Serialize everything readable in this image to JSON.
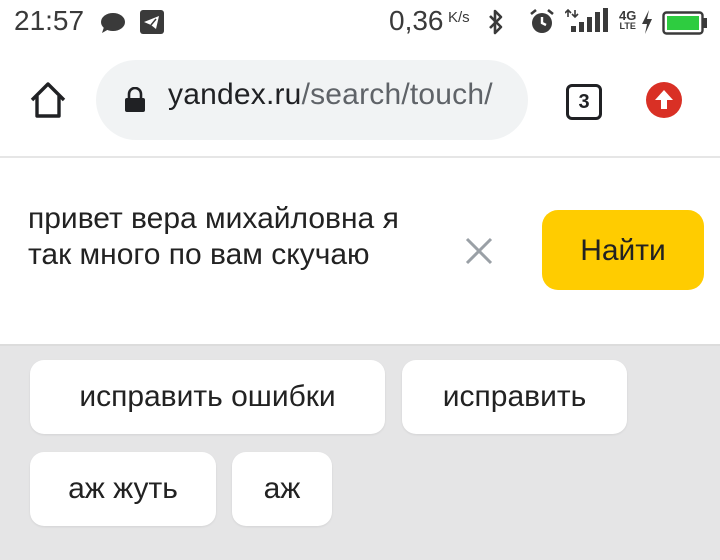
{
  "status_bar": {
    "time": "21:57",
    "net_speed_value": "0,36",
    "net_speed_unit": "K/s",
    "network_top": "4G",
    "network_bottom": "LTE",
    "icons": [
      "chat-icon",
      "telegram-icon",
      "bluetooth-icon",
      "alarm-icon",
      "signal-icon",
      "charging-icon",
      "battery-icon"
    ]
  },
  "browser": {
    "url_host": "yandex.ru",
    "url_path": "/search/touch/",
    "tab_count": "3",
    "update_icon": "arrow-up-icon",
    "accent_color": "#d93025"
  },
  "search": {
    "query": "привет вера михайловна я так много по вам скучаю",
    "submit_label": "Найти",
    "submit_color": "#ffcc00"
  },
  "suggestions": [
    {
      "label": "исправить ошибки"
    },
    {
      "label": "исправить"
    },
    {
      "label": "аж жуть"
    },
    {
      "label": "аж"
    }
  ]
}
